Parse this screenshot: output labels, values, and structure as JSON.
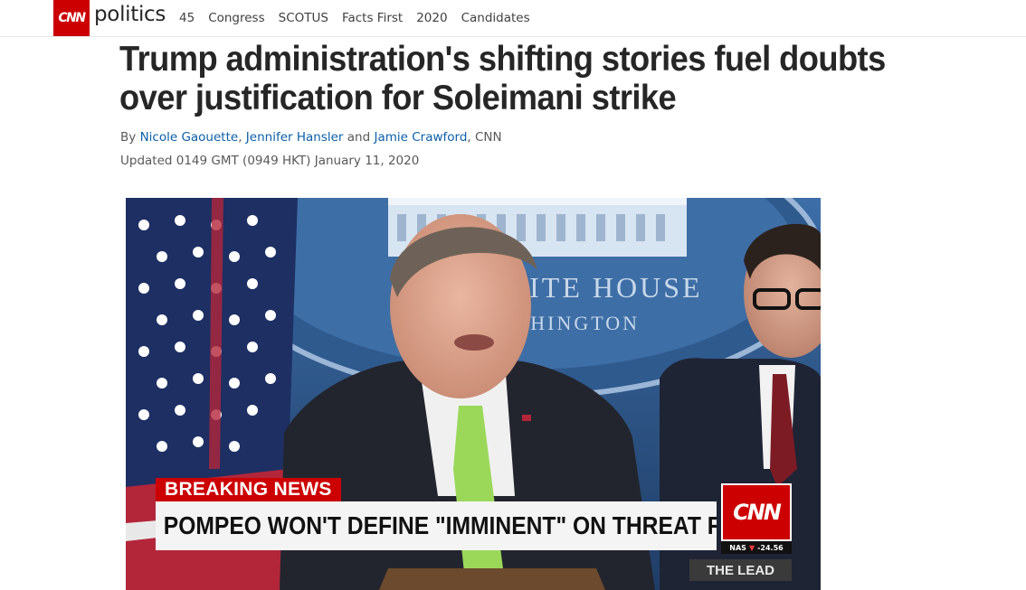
{
  "nav": {
    "logo": "CNN",
    "section": "politics",
    "links": [
      "45",
      "Congress",
      "SCOTUS",
      "Facts First",
      "2020",
      "Candidates"
    ]
  },
  "article": {
    "headline": "Trump administration's shifting stories fuel doubts over justification for Soleimani strike",
    "byline": {
      "prefix": "By",
      "authors": [
        "Nicole Gaouette",
        "Jennifer Hansler",
        "Jamie Crawford"
      ],
      "sep1": ",",
      "and": "and",
      "sep2": ",",
      "outlet": "CNN"
    },
    "updated": "Updated 0149 GMT (0949 HKT) January 11, 2020"
  },
  "video": {
    "backdrop_text_1": "HITE HOUSE",
    "backdrop_text_2": "SHINGTON",
    "breaking_label": "BREAKING NEWS",
    "banner": "POMPEO WON'T DEFINE \"IMMINENT\" ON THREAT FROM IRAN",
    "bug": "CNN",
    "ticker_name": "NAS",
    "ticker_value": "-24.56",
    "ticker_icon": "down-triangle-icon",
    "show_name": "THE LEAD"
  },
  "colors": {
    "brand_red": "#cc0000",
    "link_blue": "#0c5fa8"
  }
}
